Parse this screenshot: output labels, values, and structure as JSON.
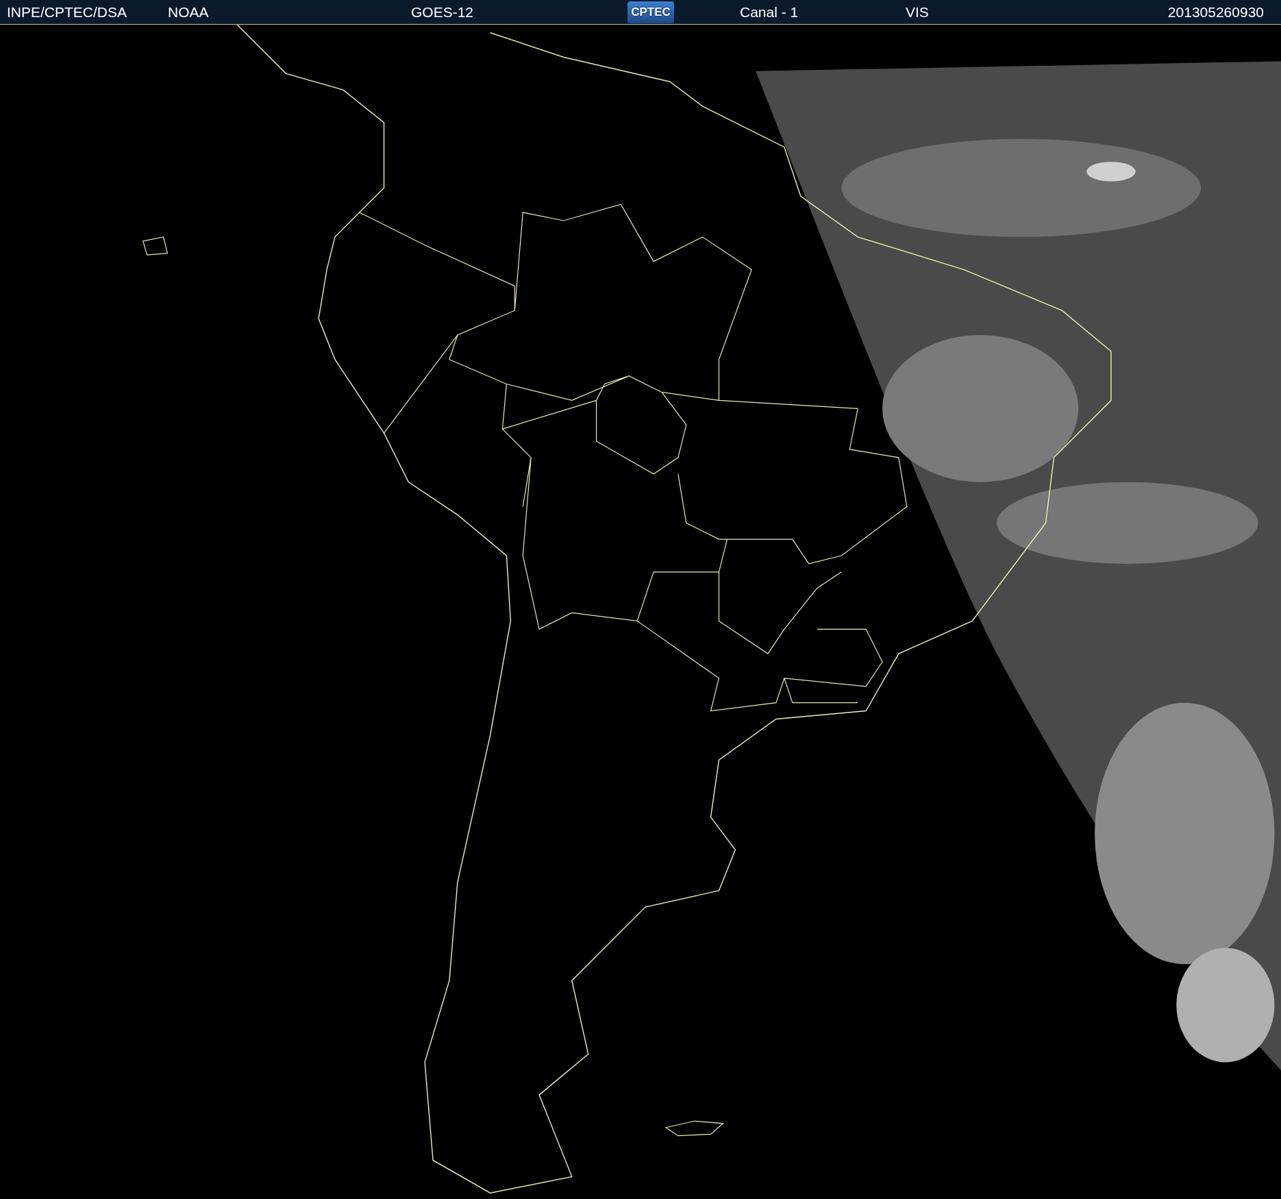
{
  "header": {
    "left": [
      "INPE/CPTEC/DSA",
      "NOAA",
      "GOES-12"
    ],
    "logo": "CPTEC",
    "right": [
      "Canal - 1",
      "VIS"
    ],
    "timestamp": "201305260930"
  }
}
